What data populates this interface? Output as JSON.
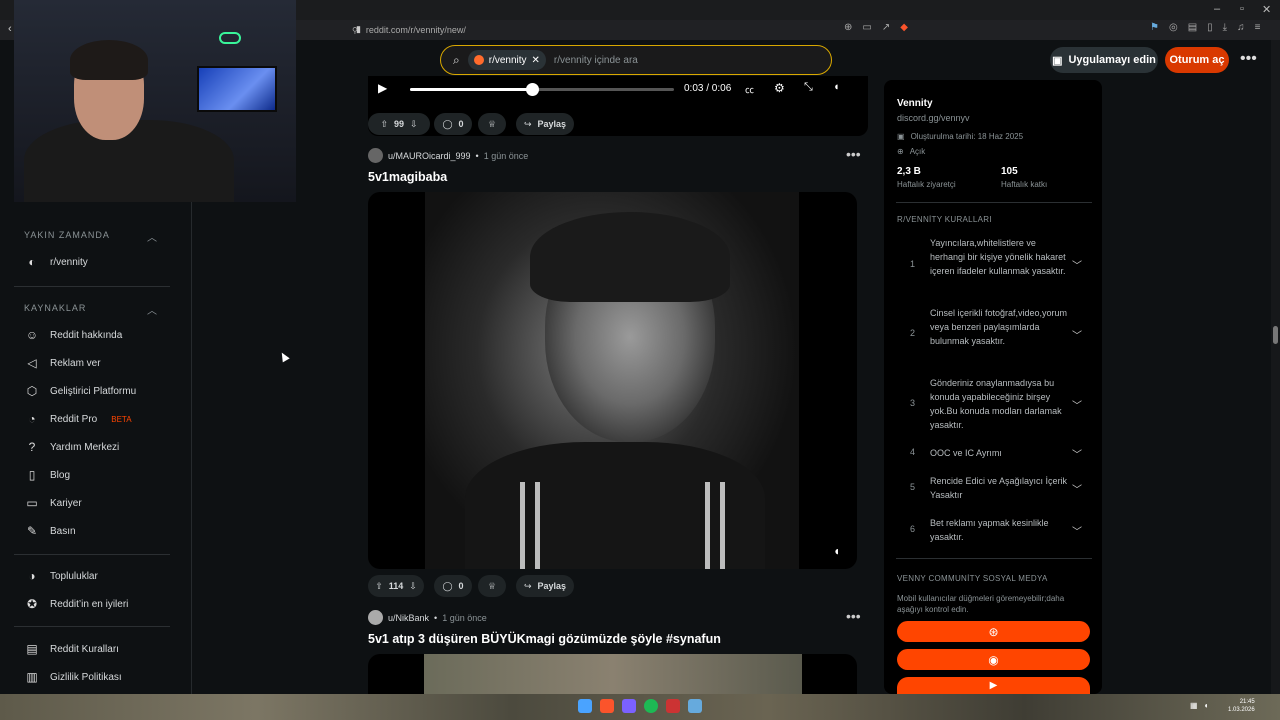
{
  "browser": {
    "url": "reddit.com/r/vennity/new/",
    "window_controls": [
      "–",
      "▫",
      "✕"
    ]
  },
  "header": {
    "search_chip": "r/vennity",
    "search_placeholder": "r/vennity içinde ara",
    "app_button": "Uygulamayı edin",
    "login_button": "Oturum aç",
    "more": "•••"
  },
  "sidebar": {
    "recent_title": "YAKIN ZAMANDA",
    "recent_items": [
      {
        "label": "r/vennity"
      }
    ],
    "resources_title": "KAYNAKLAR",
    "resources": [
      {
        "label": "Reddit hakkında",
        "icon": "reddit-alien-icon"
      },
      {
        "label": "Reklam ver",
        "icon": "megaphone-icon"
      },
      {
        "label": "Geliştirici Platformu",
        "icon": "cube-icon"
      },
      {
        "label": "Reddit Pro",
        "badge": "BETA",
        "icon": "pro-icon"
      },
      {
        "label": "Yardım Merkezi",
        "icon": "help-icon"
      },
      {
        "label": "Blog",
        "icon": "book-icon"
      },
      {
        "label": "Kariyer",
        "icon": "briefcase-icon"
      },
      {
        "label": "Basın",
        "icon": "mic-icon"
      }
    ],
    "community_items": [
      {
        "label": "Topluluklar",
        "icon": "communities-icon"
      },
      {
        "label": "Reddit’in en iyileri",
        "icon": "best-icon"
      }
    ],
    "policy_items": [
      {
        "label": "Reddit Kuralları",
        "icon": "rules-icon"
      },
      {
        "label": "Gizlilik Politikası",
        "icon": "privacy-icon"
      }
    ]
  },
  "feed": {
    "player": {
      "time": "0:03 / 0:06",
      "progress": 0.5
    },
    "post0": {
      "votes": "99",
      "comments": "0",
      "share": "Paylaş"
    },
    "post1": {
      "author": "u/MAUROicardi_999",
      "time": "1 gün önce",
      "title": "5v1magibaba",
      "votes": "114",
      "comments": "0",
      "share": "Paylaş"
    },
    "post2": {
      "author": "u/NikBank",
      "time": "1 gün önce",
      "title": "5v1 atıp 3 düşüren BÜYÜKmagi gözümüzde şöyle #synafun"
    }
  },
  "community": {
    "name": "Vennity",
    "link": "discord.gg/vennyv",
    "created": "Oluşturulma tarihi: 18 Haz 2025",
    "visibility": "Açık",
    "weekly_visitors": "2,3 B",
    "weekly_visitors_label": "Haftalık ziyaretçi",
    "weekly_contrib": "105",
    "weekly_contrib_label": "Haftalık katkı",
    "rules_title": "R/VENNİTY KURALLARI",
    "rules": [
      {
        "n": "1",
        "text": "Yayıncılara,whitelistlere ve herhangi bir kişiye yönelik hakaret içeren ifadeler kullanmak yasaktır."
      },
      {
        "n": "2",
        "text": "Cinsel içerikli fotoğraf,video,yorum veya benzeri paylaşımlarda bulunmak yasaktır."
      },
      {
        "n": "3",
        "text": "Gönderiniz onaylanmadıysa bu konuda yapabileceğiniz birşey yok.Bu konuda modları darlamak yasaktır."
      },
      {
        "n": "4",
        "text": "OOC ve IC Ayrımı"
      },
      {
        "n": "5",
        "text": "Rencide Edici ve Aşağılayıcı İçerik Yasaktır"
      },
      {
        "n": "6",
        "text": "Bet reklamı yapmak kesinlikle yasaktır."
      }
    ],
    "social_title": "VENNY COMMUNİTY SOSYAL MEDYA",
    "social_desc": "Mobil kullanıcılar düğmeleri göremeyebilir;daha aşağıyı kontrol edin.",
    "social_buttons": [
      "web-icon",
      "discord-icon",
      "youtube-icon"
    ]
  },
  "taskbar": {
    "clock_time": "21:45",
    "clock_date": "1.03.2026"
  },
  "colors": {
    "accent": "#ff4500",
    "login": "#d93900",
    "search_border": "#d9a800"
  }
}
